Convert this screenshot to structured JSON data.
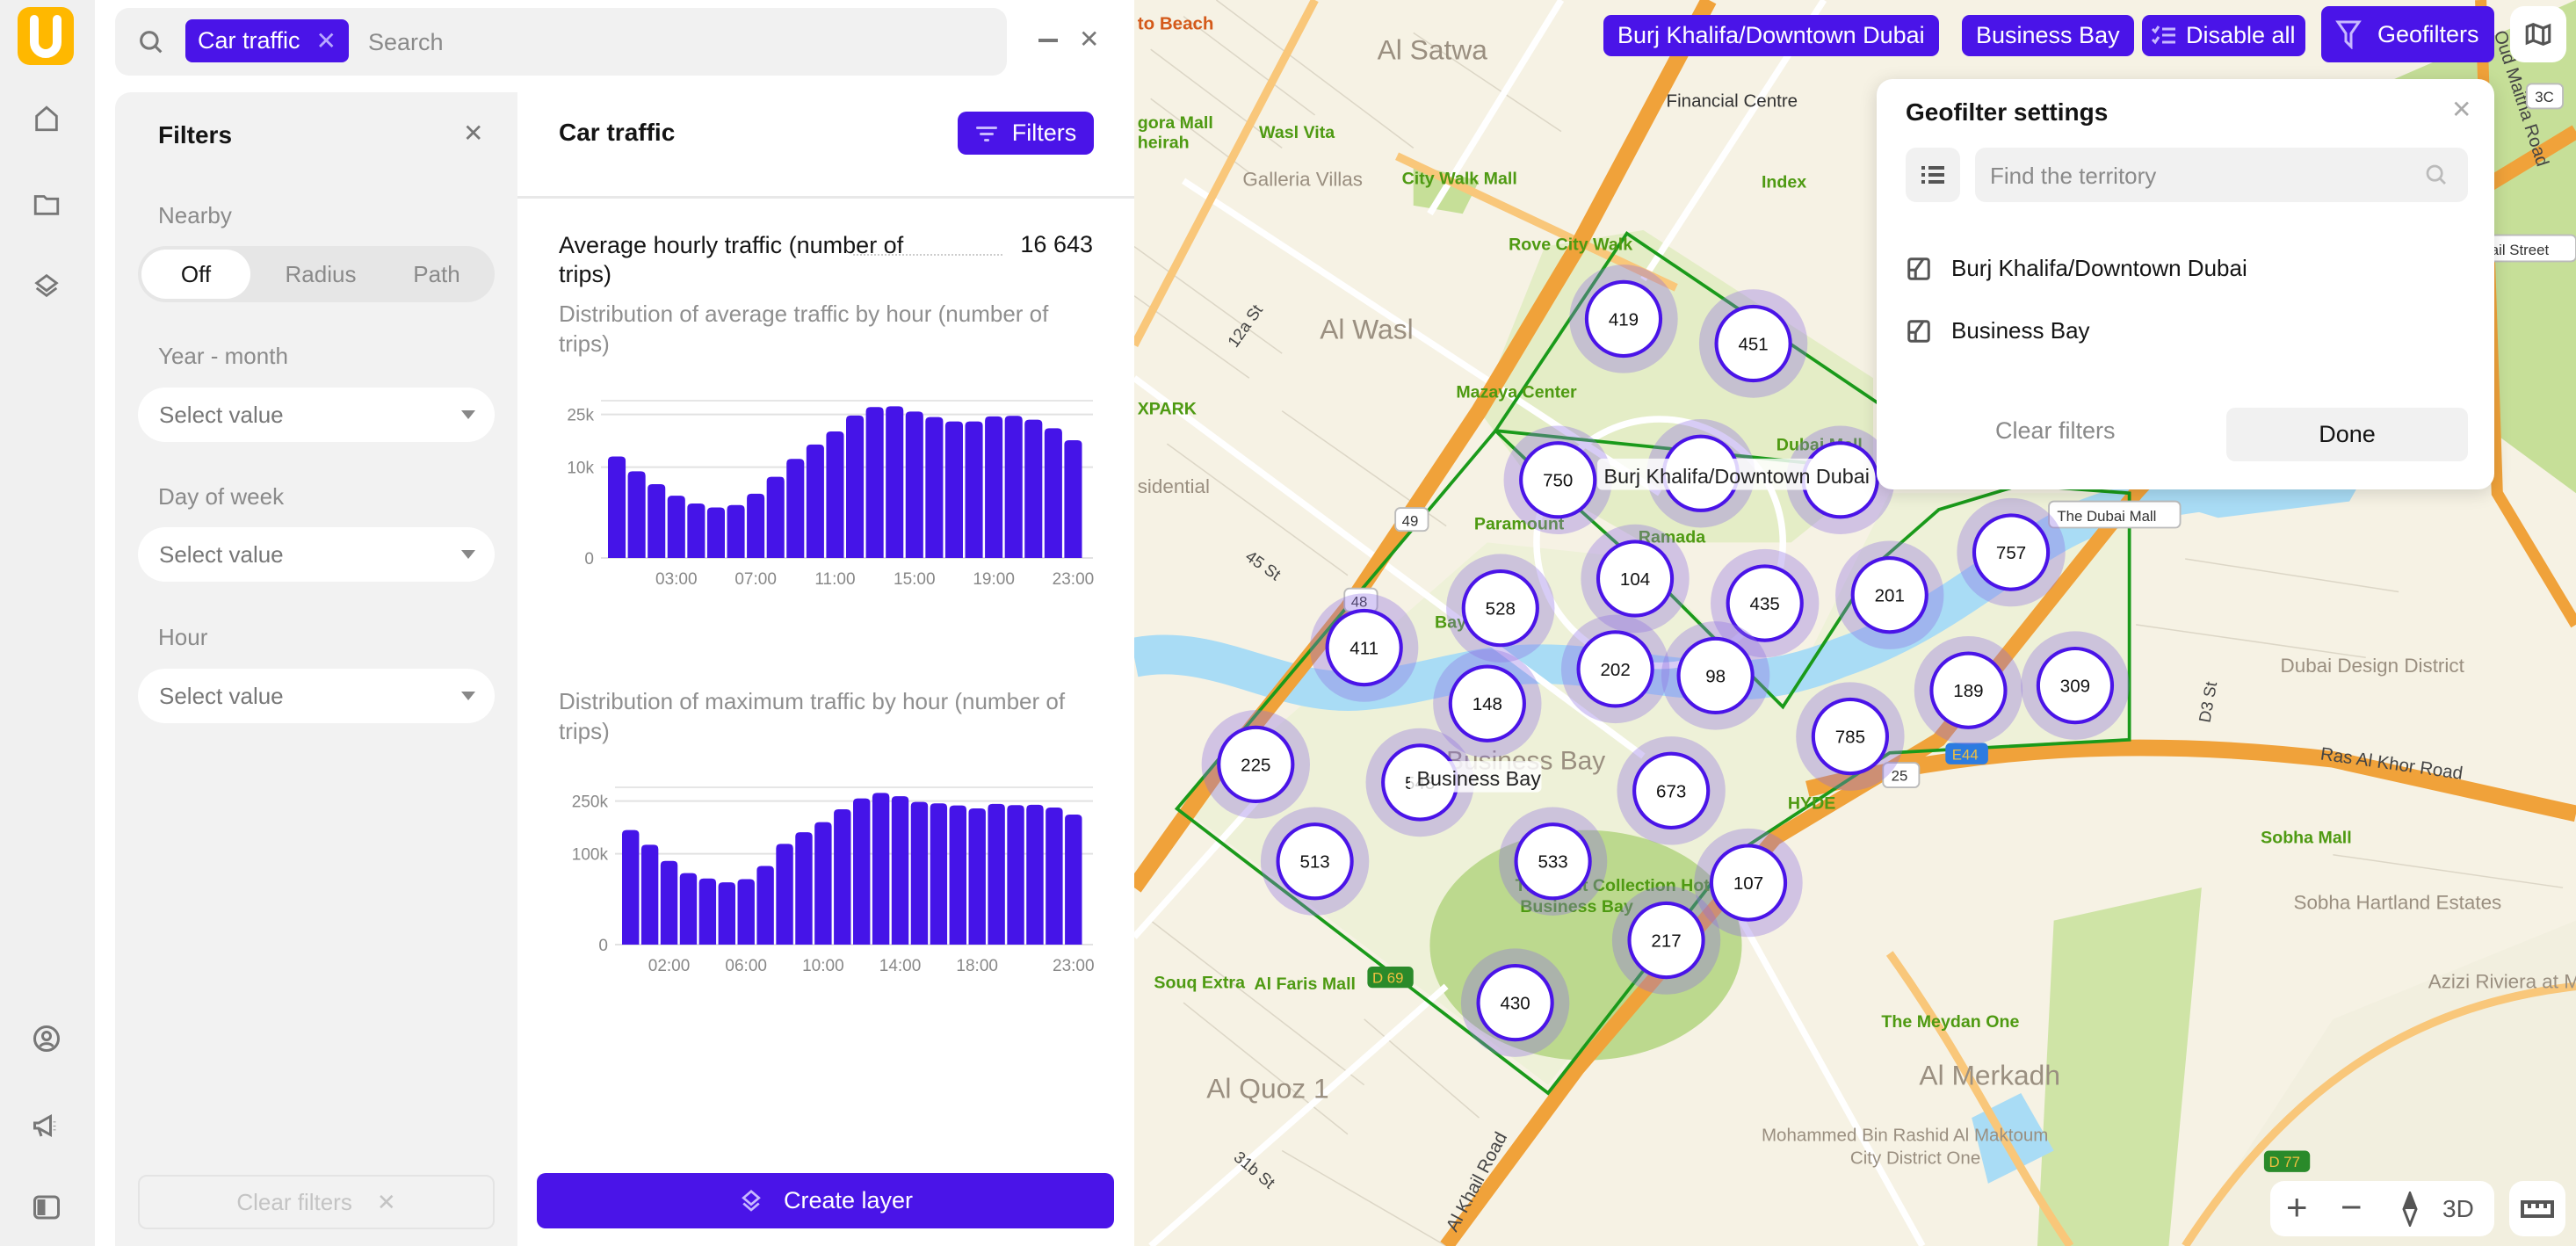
{
  "app": {
    "logo_letter": "U",
    "brand_color": "#ffb800",
    "accent": "#4a14e8"
  },
  "sidebar": {
    "items": [
      {
        "icon": "home-icon"
      },
      {
        "icon": "folder-icon"
      },
      {
        "icon": "layers-icon"
      },
      {
        "icon": "user-circle-icon"
      },
      {
        "icon": "megaphone-icon"
      },
      {
        "icon": "panel-icon"
      }
    ]
  },
  "search": {
    "chip": "Car traffic",
    "placeholder": "Search"
  },
  "filters": {
    "title": "Filters",
    "nearby_label": "Nearby",
    "nearby_options": [
      "Off",
      "Radius",
      "Path"
    ],
    "nearby_selected": "Off",
    "fields": [
      {
        "label": "Year - month",
        "value": "Select value"
      },
      {
        "label": "Day of week",
        "value": "Select value"
      },
      {
        "label": "Hour",
        "value": "Select value"
      }
    ],
    "clear_label": "Clear filters"
  },
  "main": {
    "title": "Car traffic",
    "filters_button": "Filters",
    "metric_label": "Average hourly traffic (number of trips)",
    "metric_value": "16 643",
    "create_layer": "Create layer"
  },
  "chart_data": [
    {
      "type": "bar",
      "title": "Distribution of average traffic by hour (number of trips)",
      "y_scale": "sqrt",
      "ylim": [
        0,
        30000
      ],
      "y_ticks": [
        {
          "value": 0,
          "label": "0"
        },
        {
          "value": 10000,
          "label": "10k"
        },
        {
          "value": 25000,
          "label": "25k"
        }
      ],
      "categories": [
        "00:00",
        "01:00",
        "02:00",
        "03:00",
        "04:00",
        "05:00",
        "06:00",
        "07:00",
        "08:00",
        "09:00",
        "10:00",
        "11:00",
        "12:00",
        "13:00",
        "14:00",
        "15:00",
        "16:00",
        "17:00",
        "18:00",
        "19:00",
        "20:00",
        "21:00",
        "22:00",
        "23:00"
      ],
      "x_tick_labels": [
        "03:00",
        "07:00",
        "11:00",
        "15:00",
        "19:00",
        "23:00"
      ],
      "values": [
        12500,
        9100,
        6600,
        4700,
        3600,
        3100,
        3400,
        5000,
        8000,
        11900,
        15600,
        19400,
        24600,
        27600,
        27900,
        26000,
        24100,
        22600,
        22600,
        24300,
        24500,
        23200,
        20400,
        16800
      ],
      "grid": true,
      "color": "#4514e8"
    },
    {
      "type": "bar",
      "title": "Distribution of maximum traffic by hour (number of trips)",
      "y_scale": "sqrt",
      "ylim": [
        0,
        300000
      ],
      "y_ticks": [
        {
          "value": 0,
          "label": "0"
        },
        {
          "value": 100000,
          "label": "100k"
        },
        {
          "value": 250000,
          "label": "250k"
        }
      ],
      "categories": [
        "00:00",
        "01:00",
        "02:00",
        "03:00",
        "04:00",
        "05:00",
        "06:00",
        "07:00",
        "08:00",
        "09:00",
        "10:00",
        "11:00",
        "12:00",
        "13:00",
        "14:00",
        "15:00",
        "16:00",
        "17:00",
        "18:00",
        "19:00",
        "20:00",
        "21:00",
        "22:00",
        "23:00"
      ],
      "x_tick_labels": [
        "02:00",
        "06:00",
        "10:00",
        "14:00",
        "18:00",
        "23:00"
      ],
      "values": [
        159000,
        121000,
        85000,
        62000,
        53000,
        47000,
        52000,
        75000,
        123000,
        153000,
        182000,
        222000,
        259000,
        279000,
        267000,
        247000,
        242000,
        235000,
        225000,
        240000,
        236000,
        237000,
        228000,
        205000
      ],
      "grid": true,
      "color": "#4514e8"
    }
  ],
  "map": {
    "chips": [
      "Burj Khalifa/Downtown Dubai",
      "Business Bay"
    ],
    "disable_all": "Disable all",
    "geofilters": "Geofilters",
    "geofilter_popup": {
      "title": "Geofilter settings",
      "search_placeholder": "Find the territory",
      "items": [
        "Burj Khalifa/Downtown Dubai",
        "Business Bay"
      ],
      "clear": "Clear filters",
      "done": "Done"
    },
    "controls": {
      "zoom_in": "+",
      "zoom_out": "−",
      "mode_3d": "3D"
    },
    "clusters": [
      "419",
      "451",
      "750",
      "",
      "",
      "757",
      "104",
      "435",
      "201",
      "528",
      "411",
      "202",
      "98",
      "189",
      "309",
      "148",
      "785",
      "225",
      "543",
      "673",
      "513",
      "533",
      "107",
      "217",
      "430"
    ],
    "area_labels": [
      "Burj Khalifa/Downtown Dubai",
      "Business Bay"
    ],
    "labels": {
      "districts": [
        "Al Satwa",
        "Al Wasl",
        "Galleria Villas",
        "Al Quoz 1",
        "Al Merkadh",
        "Dubai Design District",
        "Sobha Hartland Estates",
        "Azizi Riviera at M",
        "Mohammed Bin Rashid Al Maktoum",
        "City District One",
        "Business Bay",
        "sidential"
      ],
      "pois": [
        "Wasl Vita",
        "City Walk Mall",
        "Index",
        "Rove City Walk",
        "Mazaya Center",
        "XPARK",
        "Paramount",
        "Dubai Mall",
        "Ramada",
        "Bay",
        "HYDE",
        "Sobha Mall",
        "Souq Extra",
        "Al Faris Mall",
        "The First Collection Hotel",
        "Business Bay",
        "The Meydan One",
        "gora Mall",
        "heirah"
      ],
      "station": [
        "Financial Centre",
        "to Beach"
      ],
      "roads": [
        "12a St",
        "45 St",
        "Ras Al Khor Road",
        "Oud Maitha Road",
        "Al Khail Road",
        "D3 St",
        "31b St"
      ],
      "shields": [
        "3C",
        "ail Street",
        "The Dubai Mall",
        "25",
        "E44",
        "D 69",
        "D 77",
        "48",
        "49"
      ]
    }
  }
}
